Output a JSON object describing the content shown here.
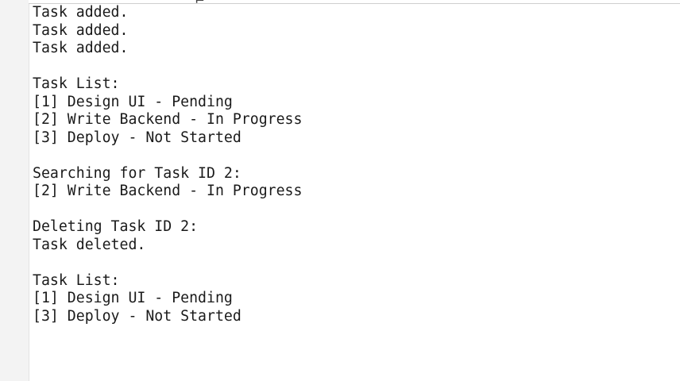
{
  "console": {
    "lines": [
      "Task added.",
      "Task added.",
      "Task added.",
      "",
      "Task List:",
      "[1] Design UI - Pending",
      "[2] Write Backend - In Progress",
      "[3] Deploy - Not Started",
      "",
      "Searching for Task ID 2:",
      "[2] Write Backend - In Progress",
      "",
      "Deleting Task ID 2:",
      "Task deleted.",
      "",
      "Task List:",
      "[1] Design UI - Pending",
      "[3] Deploy - Not Started"
    ]
  }
}
